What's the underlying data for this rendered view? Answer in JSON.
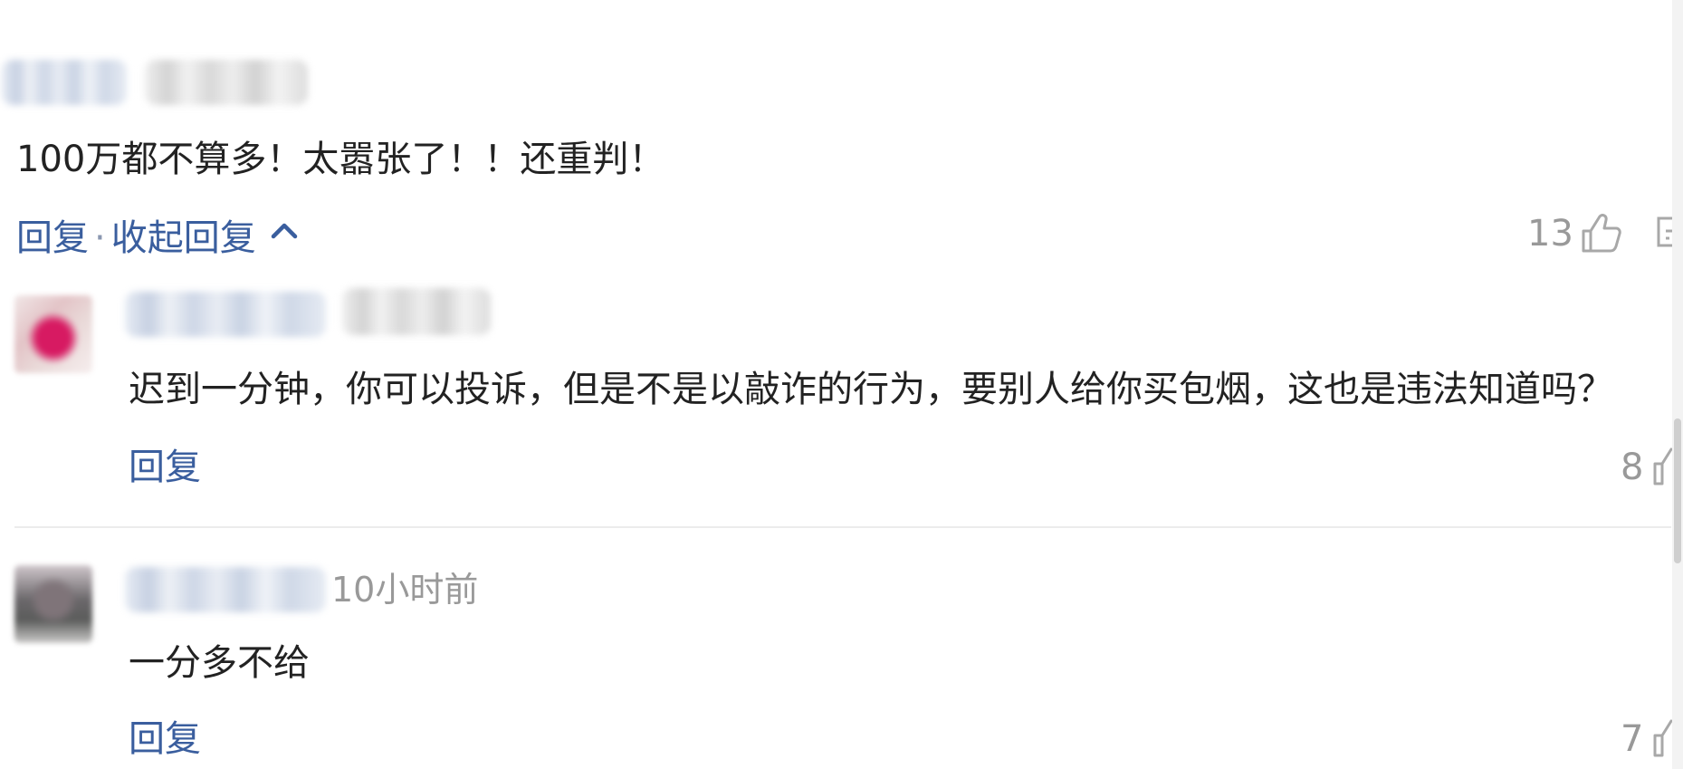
{
  "comments": [
    {
      "body": "100万都不算多！太嚣张了！！还重判！",
      "reply_label": "回复",
      "separator": "·",
      "collapse_label": "收起回复",
      "like_count": "13"
    },
    {
      "body": "迟到一分钟，你可以投诉，但是不是以敲诈的行为，要别人给你买包烟，这也是违法知道吗？",
      "reply_label": "回复",
      "like_count": "8"
    },
    {
      "time": "10小时前",
      "body": "一分多不给",
      "reply_label": "回复",
      "like_count": "7"
    }
  ],
  "icons": {
    "like": "thumbs-up-icon",
    "comment": "comment-icon",
    "collapse": "chevron-up-icon"
  },
  "colors": {
    "link": "#3a5e9e",
    "text": "#222222",
    "muted": "#999999"
  }
}
